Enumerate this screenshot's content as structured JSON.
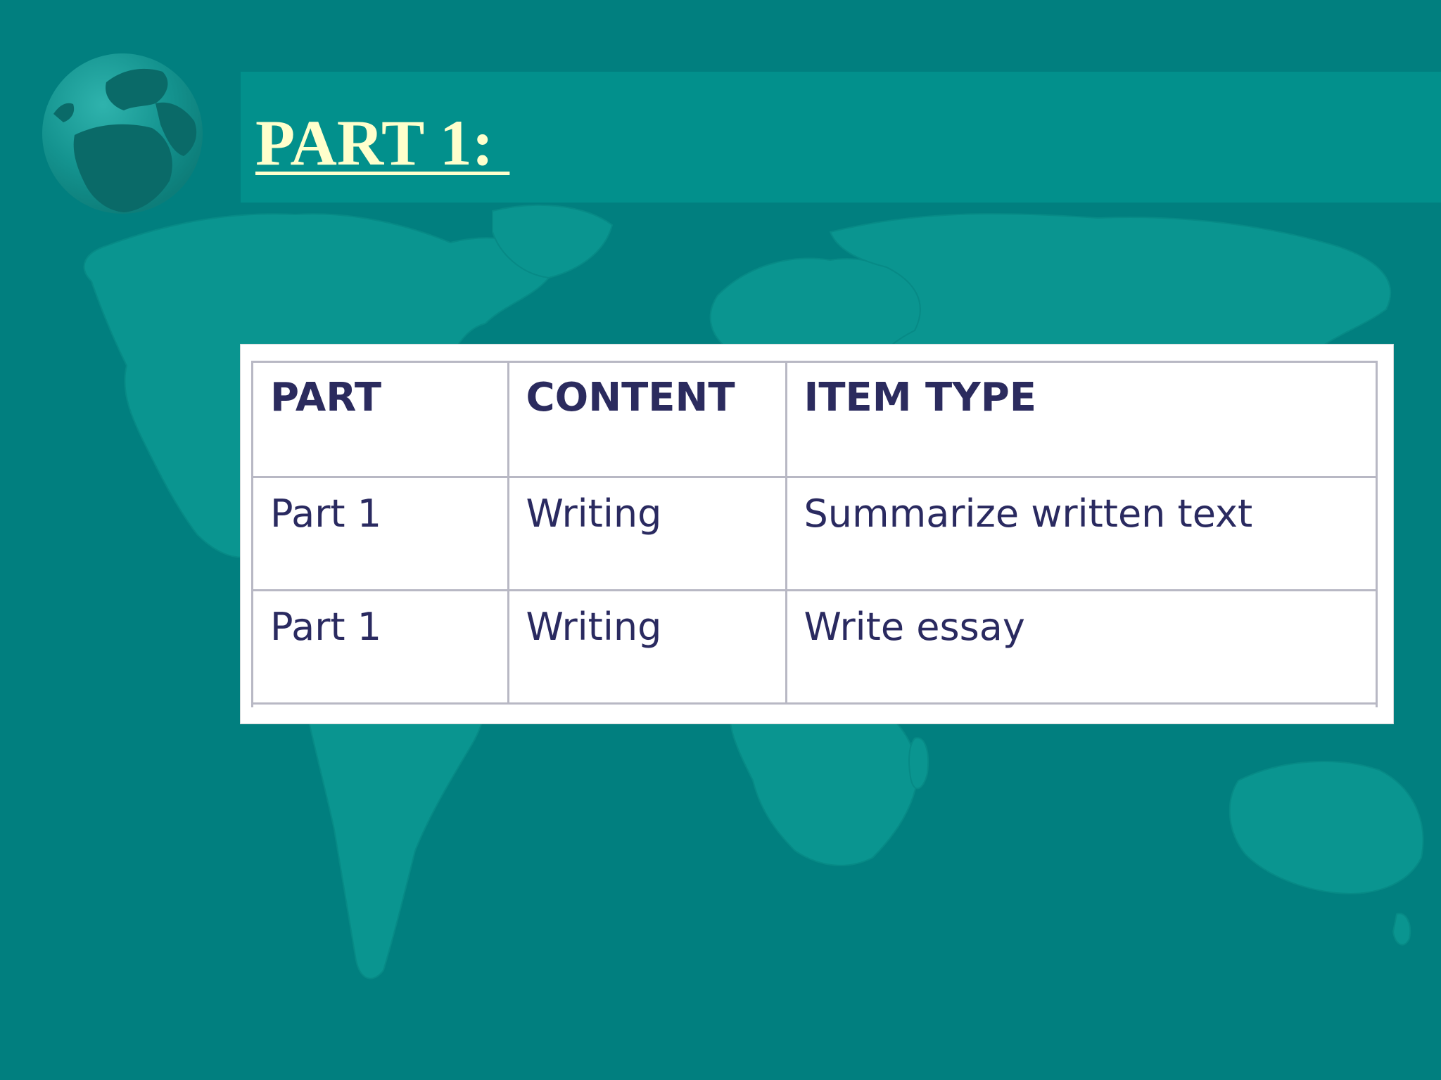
{
  "slide": {
    "title": "PART 1: "
  },
  "table": {
    "headers": [
      "PART",
      "CONTENT",
      "ITEM TYPE"
    ],
    "rows": [
      [
        "Part 1",
        "Writing",
        "Summarize written text"
      ],
      [
        "Part 1",
        "Writing",
        "Write essay"
      ]
    ]
  },
  "theme": {
    "background": "#017f7f",
    "map_land": "#0a9590",
    "title_band": "#02908c",
    "title_text": "#ffffcc",
    "table_text": "#2a2a60"
  },
  "icons": [
    "world-map-icon",
    "globe-icon"
  ]
}
